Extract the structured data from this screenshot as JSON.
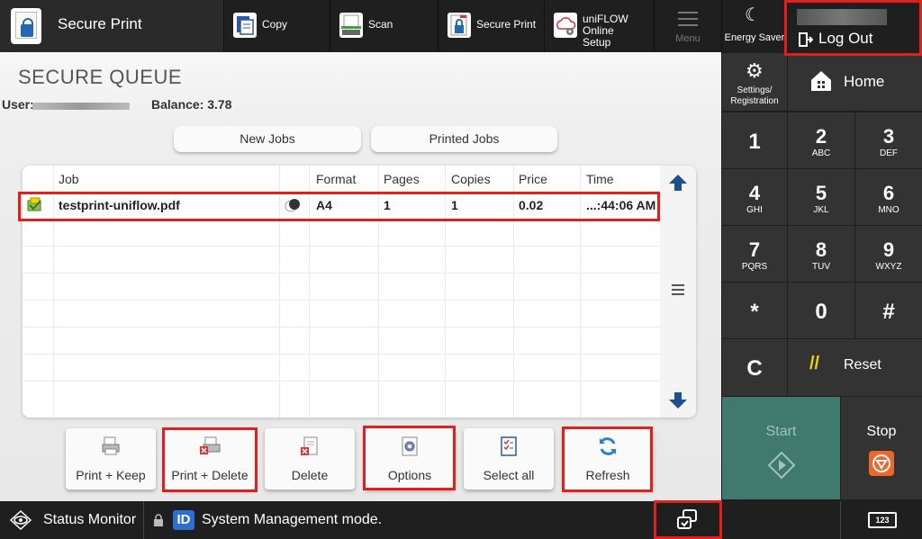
{
  "app": {
    "title": "Secure Print"
  },
  "topnav": {
    "tabs": [
      {
        "label": "Copy"
      },
      {
        "label": "Scan"
      },
      {
        "label": "Secure Print"
      },
      {
        "label": "uniFLOW Online Setup",
        "line1": "uniFLOW Online",
        "line2": "Setup"
      }
    ],
    "menu_label": "Menu",
    "energy_saver_label": "Energy Saver",
    "logout_label": "Log Out"
  },
  "queue": {
    "title": "SECURE QUEUE",
    "user_label": "User:",
    "balance_label": "Balance: 3.78",
    "tabs": [
      {
        "label": "New Jobs"
      },
      {
        "label": "Printed Jobs"
      }
    ],
    "columns": [
      "Job",
      "Format",
      "Pages",
      "Copies",
      "Price",
      "Time"
    ],
    "jobs": [
      {
        "job": "testprint-uniflow.pdf",
        "format": "A4",
        "pages": "1",
        "copies": "1",
        "price": "0.02",
        "time": "...:44:06 AM"
      }
    ]
  },
  "actions": [
    {
      "label": "Print + Keep",
      "icon": "printer-icon"
    },
    {
      "label": "Print + Delete",
      "icon": "printer-delete-icon"
    },
    {
      "label": "Delete",
      "icon": "document-delete-icon"
    },
    {
      "label": "Options",
      "icon": "gear-document-icon"
    },
    {
      "label": "Select all",
      "icon": "checklist-icon"
    },
    {
      "label": "Refresh",
      "icon": "refresh-icon"
    }
  ],
  "keypad": {
    "settings_label": "Settings/ Registration",
    "settings_line1": "Settings/",
    "settings_line2": "Registration",
    "home_label": "Home",
    "keys": [
      {
        "main": "1",
        "sub": ""
      },
      {
        "main": "2",
        "sub": "ABC"
      },
      {
        "main": "3",
        "sub": "DEF"
      },
      {
        "main": "4",
        "sub": "GHI"
      },
      {
        "main": "5",
        "sub": "JKL"
      },
      {
        "main": "6",
        "sub": "MNO"
      },
      {
        "main": "7",
        "sub": "PQRS"
      },
      {
        "main": "8",
        "sub": "TUV"
      },
      {
        "main": "9",
        "sub": "WXYZ"
      },
      {
        "main": "*",
        "sub": ""
      },
      {
        "main": "0",
        "sub": ""
      },
      {
        "main": "#",
        "sub": ""
      }
    ],
    "clear_label": "C",
    "reset_label": "Reset",
    "start_label": "Start",
    "stop_label": "Stop"
  },
  "statusbar": {
    "status_monitor_label": "Status Monitor",
    "id_badge": "ID",
    "message": "System Management mode.",
    "counter_label": "123"
  },
  "colors": {
    "highlight": "#e0201e",
    "start_green": "#3f7a6c",
    "stop_orange": "#f0662a",
    "arrow_blue": "#1e4f8f"
  }
}
